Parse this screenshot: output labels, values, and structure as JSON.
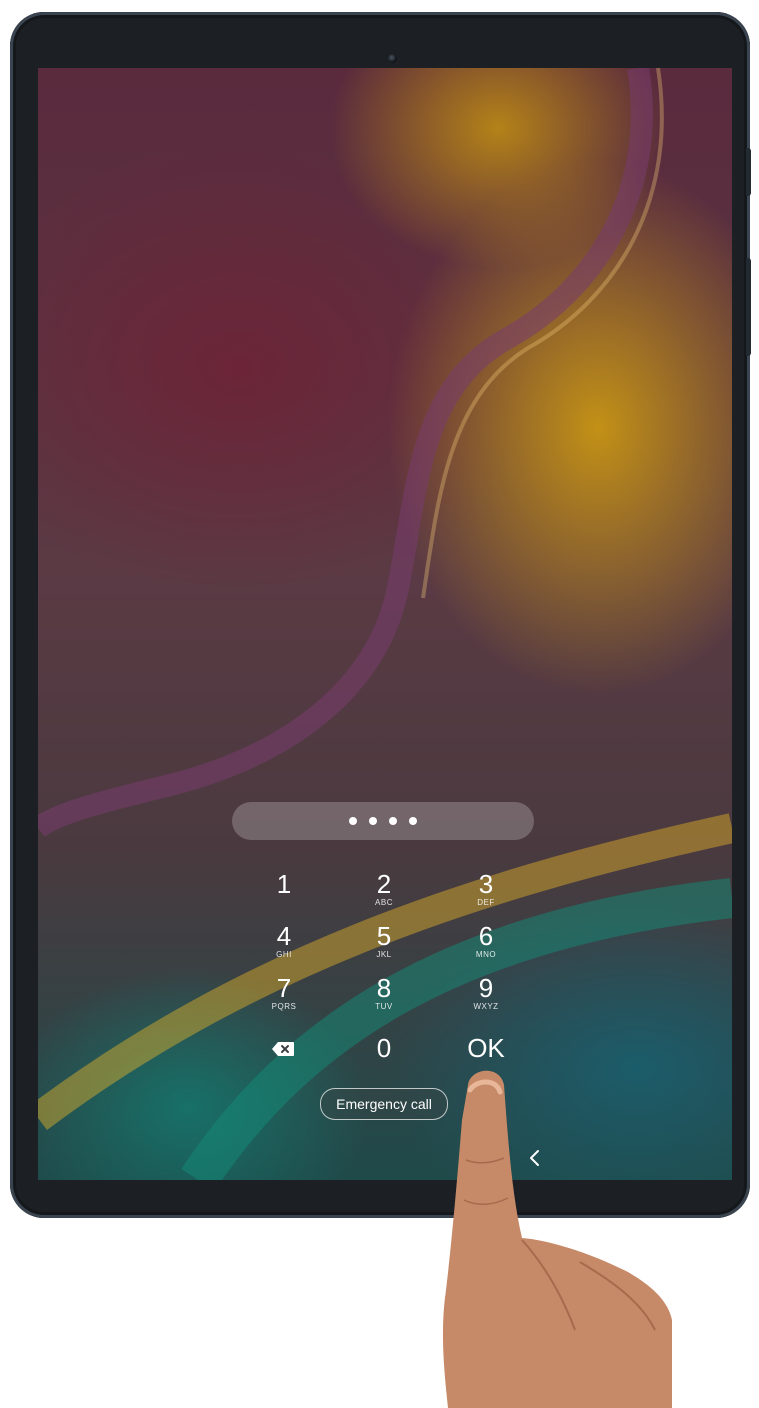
{
  "lock_screen": {
    "pin_entered_count": 4,
    "keypad": [
      {
        "num": "1",
        "letters": ""
      },
      {
        "num": "2",
        "letters": "ABC"
      },
      {
        "num": "3",
        "letters": "DEF"
      },
      {
        "num": "4",
        "letters": "GHI"
      },
      {
        "num": "5",
        "letters": "JKL"
      },
      {
        "num": "6",
        "letters": "MNO"
      },
      {
        "num": "7",
        "letters": "PQRS"
      },
      {
        "num": "8",
        "letters": "TUV"
      },
      {
        "num": "9",
        "letters": "WXYZ"
      },
      {
        "num": "0",
        "letters": ""
      },
      {
        "num": "OK",
        "letters": ""
      }
    ],
    "backspace_icon": "backspace-icon",
    "emergency_call_label": "Emergency call",
    "nav_back_icon": "chevron-left-icon"
  },
  "colors": {
    "bezel": "#1c2024",
    "key_text": "#ffffff",
    "pin_field_bg": "rgba(255,255,255,0.22)"
  }
}
